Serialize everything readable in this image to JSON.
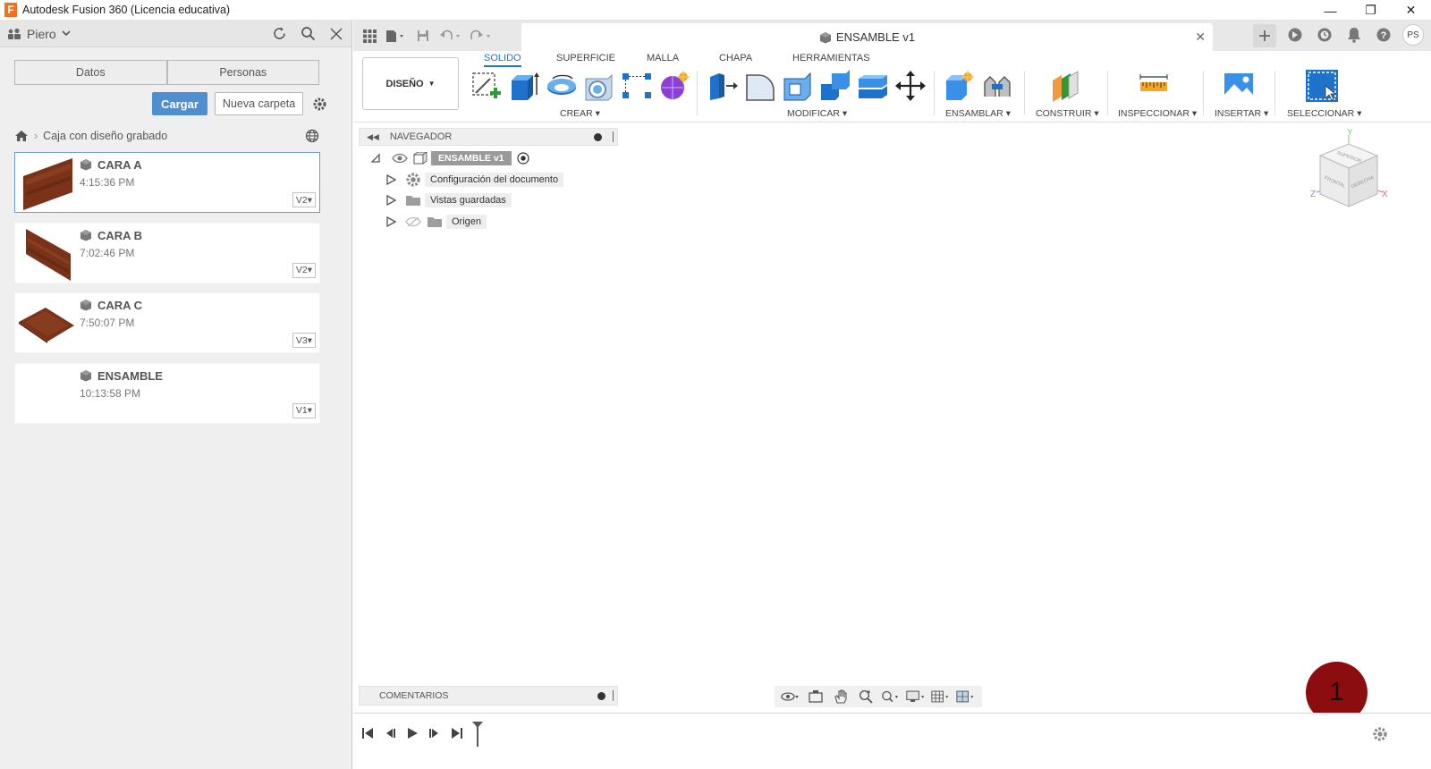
{
  "window": {
    "title": "Autodesk Fusion 360 (Licencia educativa)",
    "logo_letter": "F",
    "minimize": "—",
    "restore": "❐",
    "close": "✕"
  },
  "data_panel": {
    "user": "Piero",
    "tabs": [
      "Datos",
      "Personas"
    ],
    "upload_label": "Cargar",
    "new_folder_label": "Nueva carpeta",
    "breadcrumb": "Caja con diseño grabado",
    "files": [
      {
        "name": "CARA A",
        "time": "4:15:36 PM",
        "version": "V2"
      },
      {
        "name": "CARA B",
        "time": "7:02:46 PM",
        "version": "V2"
      },
      {
        "name": "CARA C",
        "time": "7:50:07 PM",
        "version": "V3"
      },
      {
        "name": "ENSAMBLE",
        "time": "10:13:58 PM",
        "version": "V1"
      }
    ]
  },
  "document": {
    "tab_title": "ENSAMBLE v1",
    "avatar_initials": "PS"
  },
  "ribbon": {
    "workspace": "DISEÑO",
    "tabs": [
      "SOLIDO",
      "SUPERFICIE",
      "MALLA",
      "CHAPA",
      "HERRAMIENTAS"
    ],
    "groups": [
      "CREAR",
      "MODIFICAR",
      "ENSAMBLAR",
      "CONSTRUIR",
      "INSPECCIONAR",
      "INSERTAR",
      "SELECCIONAR"
    ]
  },
  "browser": {
    "title": "NAVEGADOR",
    "root": "ENSAMBLE v1",
    "nodes": [
      "Configuración del documento",
      "Vistas guardadas",
      "Origen"
    ]
  },
  "viewcube": {
    "axis_y": "Y",
    "axis_x": "X",
    "axis_z": "Z",
    "face_top": "SUPERIOR",
    "face_front": "FRONTAL",
    "face_right": "DERECHA"
  },
  "comments": {
    "title": "COMENTARIOS"
  },
  "badge": {
    "number": "1"
  },
  "colors": {
    "accent": "#1b76d2",
    "upload_button": "#4f8fd0",
    "badge": "#8b0d10",
    "wood": "#7a3319"
  }
}
